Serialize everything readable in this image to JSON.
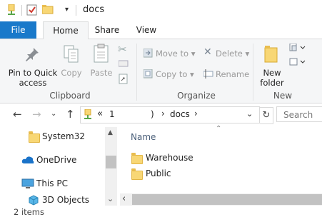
{
  "titlebar": {
    "title": "docs"
  },
  "tabs": [
    {
      "label": "File"
    },
    {
      "label": "Home"
    },
    {
      "label": "Share"
    },
    {
      "label": "View"
    }
  ],
  "ribbon": {
    "clipboard": {
      "pin_label": "Pin to Quick access",
      "copy_label": "Copy",
      "paste_label": "Paste",
      "group_label": "Clipboard"
    },
    "organize": {
      "move_to": "Move to",
      "copy_to": "Copy to",
      "delete": "Delete",
      "rename": "Rename",
      "group_label": "Organize"
    },
    "new": {
      "new_folder": "New folder",
      "group_label": "New"
    }
  },
  "address": {
    "overflow": "«",
    "crumb1": "1",
    "crumb2": ")",
    "crumb3": "docs",
    "search_placeholder": "Search"
  },
  "nav": {
    "items": [
      {
        "label": "System32"
      },
      {
        "label": "OneDrive"
      },
      {
        "label": "This PC"
      },
      {
        "label": "3D Objects"
      }
    ]
  },
  "content": {
    "column_name": "Name",
    "files": [
      {
        "name": "Warehouse"
      },
      {
        "name": "Public"
      }
    ]
  },
  "status": {
    "items_count": "2 items"
  },
  "colors": {
    "file_tab": "#1979ca",
    "ribbon_bg": "#f5f6f7",
    "folder": "#f8d775"
  }
}
